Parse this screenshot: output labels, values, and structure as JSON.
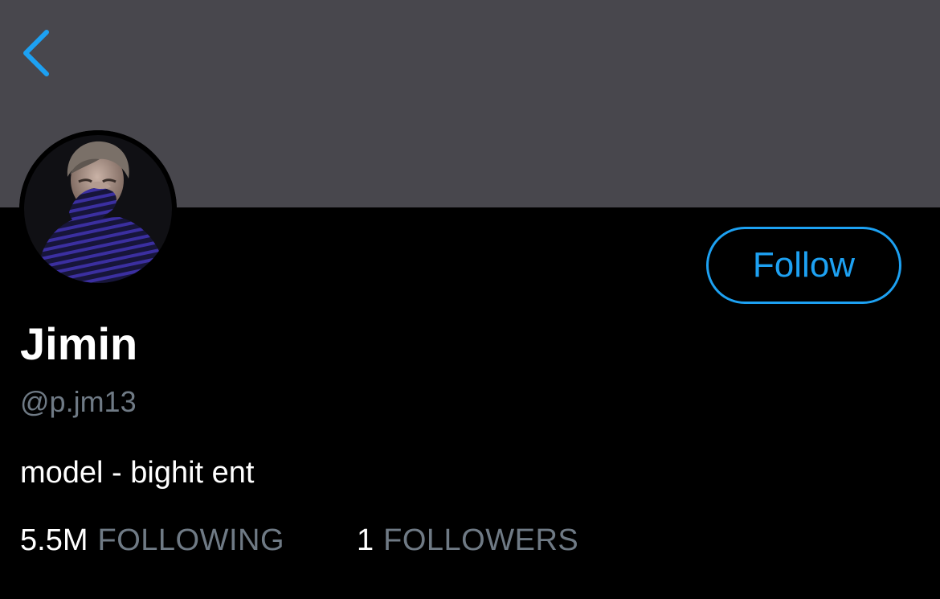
{
  "header": {
    "back_icon": "chevron-left-icon",
    "accent_color": "#1da1f2",
    "banner_color": "#48474d"
  },
  "profile": {
    "avatar_icon": "profile-photo",
    "display_name": "Jimin",
    "handle": "@p.jm13",
    "bio": "model - bighit ent",
    "follow_label": "Follow"
  },
  "stats": {
    "following_count": "5.5M",
    "following_label": "FOLLOWING",
    "followers_count": "1",
    "followers_label": "FOLLOWERS"
  }
}
